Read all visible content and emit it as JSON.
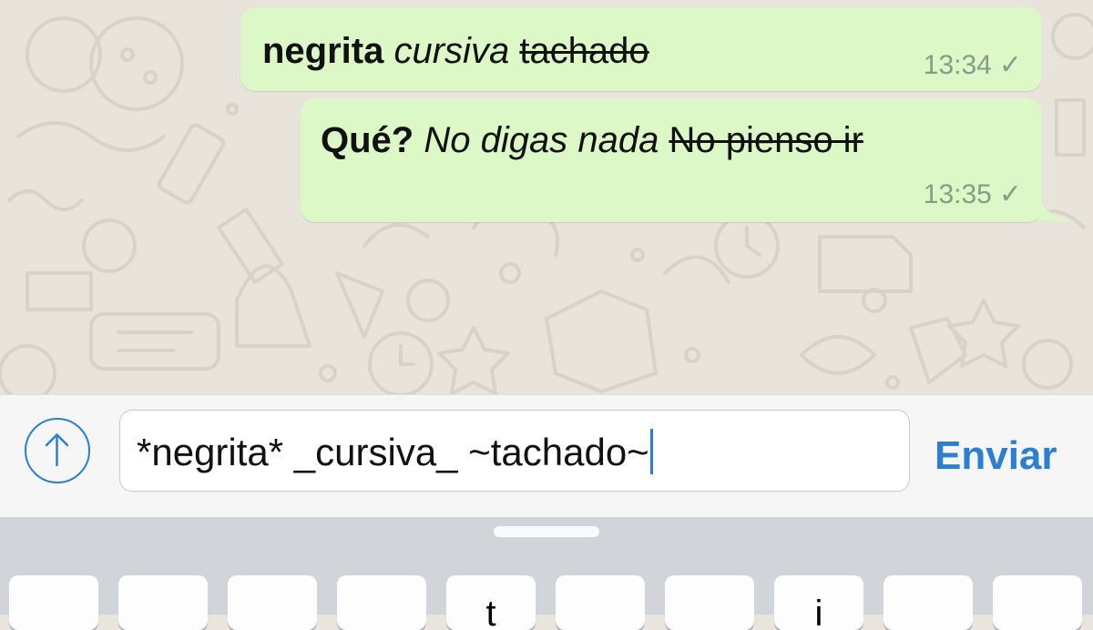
{
  "messages": [
    {
      "bold": "negrita",
      "italic": "cursiva",
      "strike": "tachado",
      "time": "13:34",
      "status_icon": "single-check-icon"
    },
    {
      "bold": "Qué?",
      "italic": "No digas nada",
      "strike": "No pienso ir",
      "time": "13:35",
      "status_icon": "single-check-icon"
    }
  ],
  "composer": {
    "attach_icon": "arrow-up-circle-icon",
    "input_value": "*negrita* _cursiva_ ~tachado~",
    "send_label": "Enviar"
  },
  "keyboard": {
    "keys": [
      "",
      "",
      "",
      "",
      "",
      "",
      "",
      "",
      "",
      ""
    ],
    "partial_glyphs": {
      "key5": "t",
      "key8": "i"
    }
  },
  "colors": {
    "bubble_outgoing": "#dcf8c6",
    "accent": "#2b7fd3",
    "chat_background": "#e8e4dc",
    "keyboard_background": "#d1d4d9"
  }
}
